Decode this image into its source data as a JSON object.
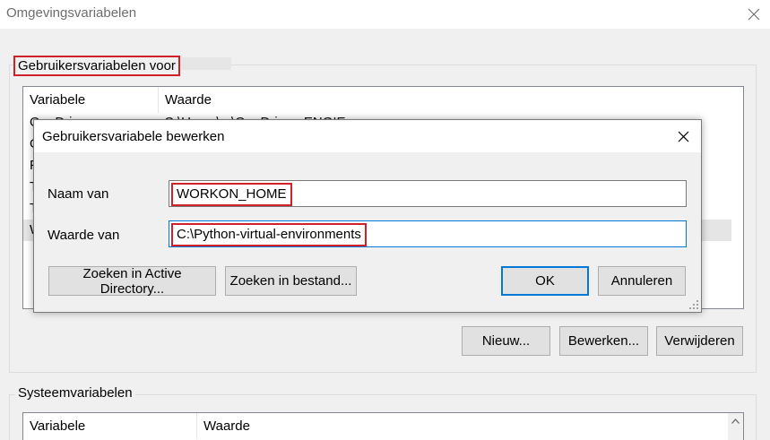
{
  "window": {
    "title": "Omgevingsvariabelen"
  },
  "user_group": {
    "label": "Gebruikersvariabelen voor",
    "columns": [
      "Variabele",
      "Waarde"
    ],
    "rows": [
      {
        "variable": "OneDrive",
        "value": "C:\\Users\\...\\OneDrive - ENGIE"
      },
      {
        "variable": "O",
        "value": ""
      },
      {
        "variable": "P",
        "value": ""
      },
      {
        "variable": "T",
        "value": ""
      },
      {
        "variable": "T",
        "value": ""
      },
      {
        "variable": "W",
        "value": ""
      }
    ],
    "buttons": {
      "new": "Nieuw...",
      "edit": "Bewerken...",
      "delete": "Verwijderen"
    }
  },
  "system_group": {
    "label": "Systeemvariabelen",
    "columns": [
      "Variabele",
      "Waarde"
    ]
  },
  "dialog": {
    "title": "Gebruikersvariabele bewerken",
    "name_label": "Naam van",
    "name_value": "WORKON_HOME",
    "value_label": "Waarde van",
    "value_value": "C:\\Python-virtual-environments",
    "btn_ad": "Zoeken in Active Directory...",
    "btn_file": "Zoeken in bestand...",
    "btn_ok": "OK",
    "btn_cancel": "Annuleren"
  },
  "icons": [
    "close-icon",
    "chevron-up-icon",
    "resize-grip-icon"
  ],
  "colors": {
    "highlight": "#d0202a",
    "focus": "#0078d7"
  }
}
